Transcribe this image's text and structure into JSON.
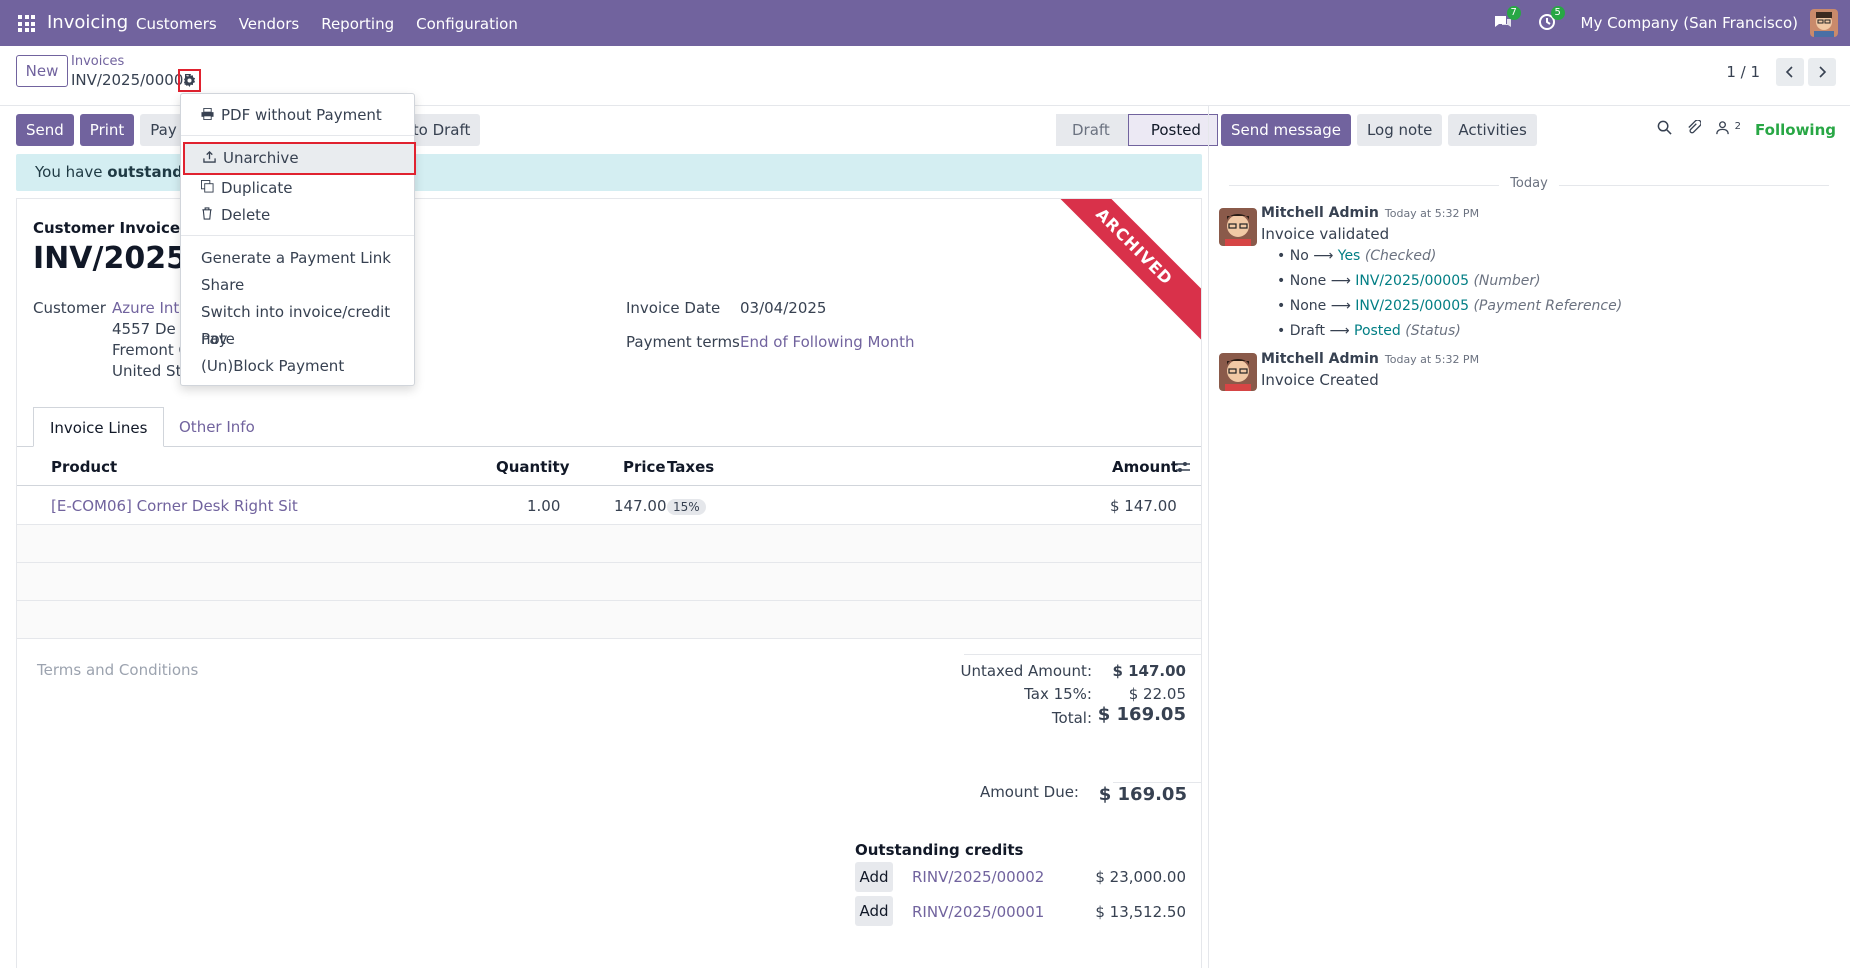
{
  "topbar": {
    "app_name": "Invoicing",
    "menu": [
      "Customers",
      "Vendors",
      "Reporting",
      "Configuration"
    ],
    "chat_badge": "7",
    "activity_badge": "5",
    "company": "My Company (San Francisco)"
  },
  "control": {
    "new_label": "New",
    "breadcrumb_parent": "Invoices",
    "breadcrumb_current": "INV/2025/00005",
    "pager": "1 / 1"
  },
  "actions": {
    "send": "Send",
    "print": "Print",
    "pay": "Pay",
    "reset_draft": "to Draft"
  },
  "status": {
    "draft": "Draft",
    "posted": "Posted"
  },
  "alert": {
    "prefix": "You have ",
    "bold": "outstanding"
  },
  "invoice": {
    "type": "Customer Invoice",
    "name": "INV/2025/0",
    "ribbon": "ARCHIVED",
    "customer_label": "Customer",
    "customer_name": "Azure Inter",
    "address_1": "4557 De Si",
    "address_2": "Fremont C",
    "address_3": "United Sta",
    "date_label": "Invoice Date",
    "date_value": "03/04/2025",
    "terms_label": "Payment terms",
    "terms_value": "End of Following Month"
  },
  "tabs": {
    "lines": "Invoice Lines",
    "other": "Other Info"
  },
  "lines": {
    "headers": {
      "product": "Product",
      "quantity": "Quantity",
      "price": "Price",
      "taxes": "Taxes",
      "amount": "Amount"
    },
    "rows": [
      {
        "product": "[E-COM06] Corner Desk Right Sit",
        "quantity": "1.00",
        "price": "147.00",
        "tax": "15%",
        "amount": "$ 147.00"
      }
    ]
  },
  "terms_placeholder": "Terms and Conditions",
  "totals": {
    "untaxed_label": "Untaxed Amount:",
    "untaxed_value": "$ 147.00",
    "tax_label": "Tax 15%:",
    "tax_value": "$ 22.05",
    "total_label": "Total:",
    "total_value": "$ 169.05",
    "due_label": "Amount Due:",
    "due_value": "$ 169.05"
  },
  "credits": {
    "title": "Outstanding credits",
    "add_label": "Add",
    "items": [
      {
        "ref": "RINV/2025/00002",
        "amount": "$ 23,000.00"
      },
      {
        "ref": "RINV/2025/00001",
        "amount": "$ 13,512.50"
      }
    ]
  },
  "chatter": {
    "send_message": "Send message",
    "log_note": "Log note",
    "activities": "Activities",
    "followers_count": "2",
    "following": "Following",
    "today": "Today",
    "messages": [
      {
        "author": "Mitchell Admin",
        "time": "Today at 5:32 PM",
        "body": "Invoice validated",
        "tracking": [
          {
            "old": "No",
            "new": "Yes",
            "field": "(Checked)"
          },
          {
            "old": "None",
            "new": "INV/2025/00005",
            "field": "(Number)"
          },
          {
            "old": "None",
            "new": "INV/2025/00005",
            "field": "(Payment Reference)"
          },
          {
            "old": "Draft",
            "new": "Posted",
            "field": "(Status)"
          }
        ]
      },
      {
        "author": "Mitchell Admin",
        "time": "Today at 5:32 PM",
        "body": "Invoice Created"
      }
    ]
  },
  "gear_menu": {
    "items": [
      "PDF without Payment",
      "Unarchive",
      "Duplicate",
      "Delete",
      "Generate a Payment Link",
      "Share",
      "Switch into invoice/credit note",
      "Pay",
      "(Un)Block Payment"
    ]
  },
  "colors": {
    "brand": "#71639e",
    "highlight_border": "#e0222f",
    "ribbon": "#d9314a",
    "following": "#28a745",
    "tracking_new": "#017e84"
  }
}
